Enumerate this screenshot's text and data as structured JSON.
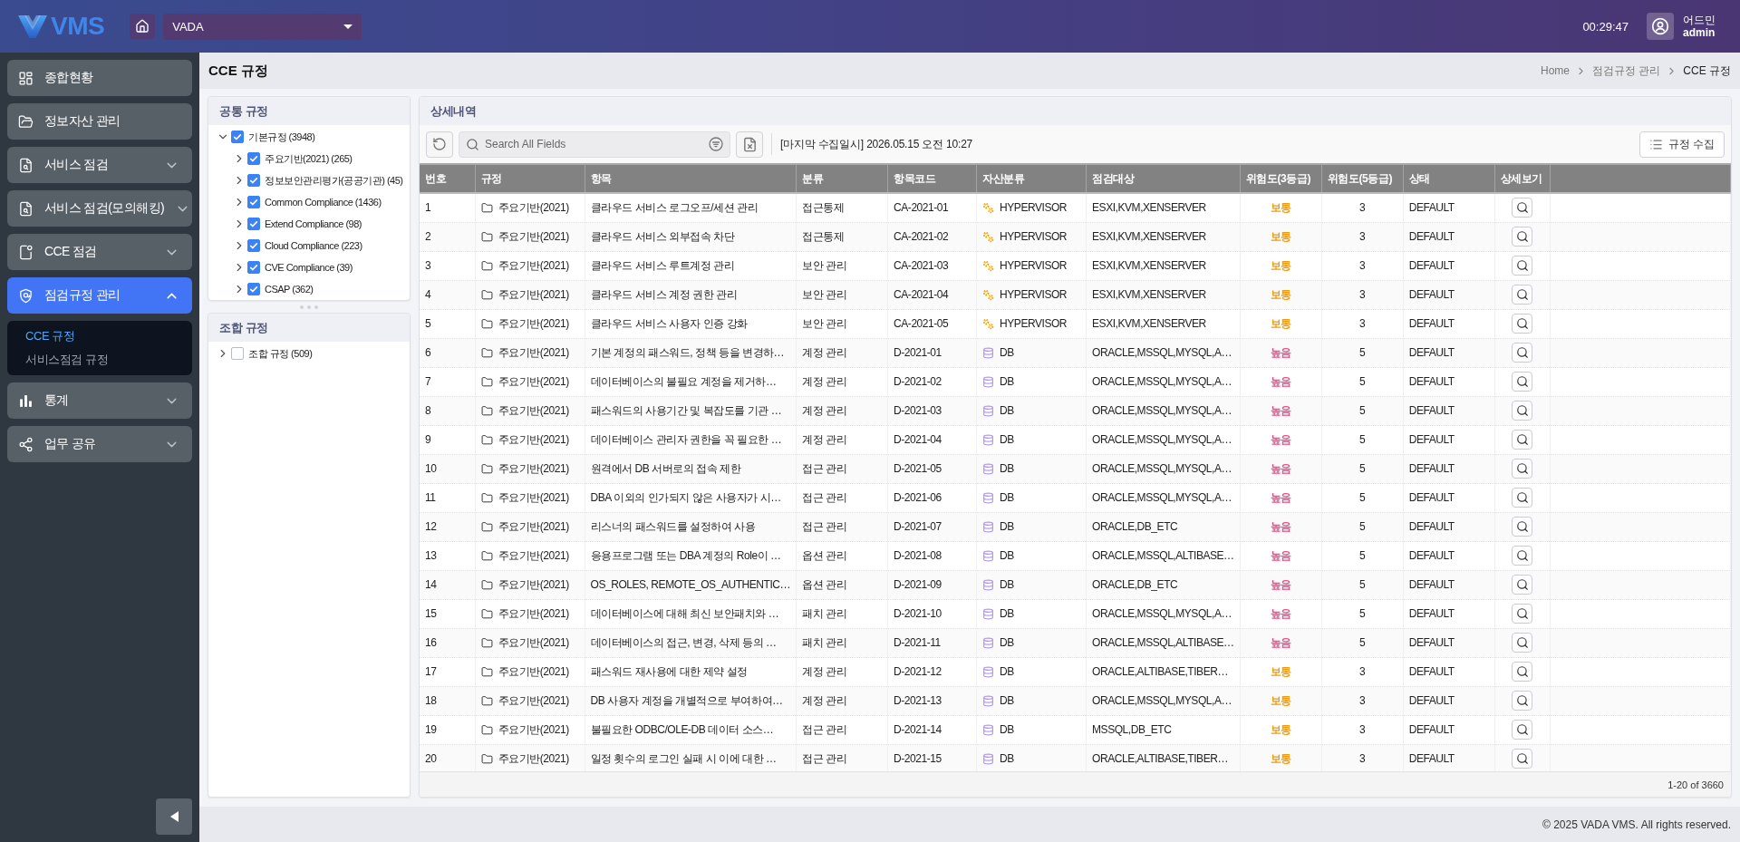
{
  "header": {
    "logo_text": "VMS",
    "site_select": {
      "value": "VADA"
    },
    "clock": "00:29:47",
    "user": {
      "name": "어드민",
      "id": "admin"
    }
  },
  "sidebar": {
    "items": [
      {
        "label": "종합현황",
        "kind": "link",
        "selected": false
      },
      {
        "label": "정보자산 관리",
        "kind": "link",
        "selected": false
      },
      {
        "label": "서비스 점검",
        "kind": "group",
        "selected": false,
        "expanded": false
      },
      {
        "label": "서비스 점검(모의해킹)",
        "kind": "group",
        "selected": false,
        "expanded": false
      },
      {
        "label": "CCE 점검",
        "kind": "group",
        "selected": false,
        "expanded": false
      },
      {
        "label": "점검규정 관리",
        "kind": "group",
        "selected": true,
        "expanded": true,
        "children": [
          {
            "label": "CCE 규정",
            "selected": true
          },
          {
            "label": "서비스점검 규정",
            "selected": false
          }
        ]
      },
      {
        "label": "통계",
        "kind": "group",
        "selected": false,
        "expanded": false
      },
      {
        "label": "업무 공유",
        "kind": "group",
        "selected": false,
        "expanded": false
      }
    ]
  },
  "page": {
    "title": "CCE 규정",
    "breadcrumb": [
      {
        "label": "Home",
        "current": false
      },
      {
        "label": "점검규정 관리",
        "current": false
      },
      {
        "label": "CCE 규정",
        "current": true
      }
    ]
  },
  "common_rules": {
    "title": "공통 규정",
    "tree": [
      {
        "label": "기본규정 (3948)",
        "checked": true,
        "expanded": true,
        "children": [
          {
            "label": "주요기반(2021) (265)",
            "checked": true,
            "expanded": false
          },
          {
            "label": "정보보안관리평가(공공기관) (45)",
            "checked": true,
            "expanded": false
          },
          {
            "label": "Common Compliance (1436)",
            "checked": true,
            "expanded": false
          },
          {
            "label": "Extend Compliance (98)",
            "checked": true,
            "expanded": false
          },
          {
            "label": "Cloud Compliance (223)",
            "checked": true,
            "expanded": false
          },
          {
            "label": "CVE Compliance (39)",
            "checked": true,
            "expanded": false
          },
          {
            "label": "CSAP (362)",
            "checked": true,
            "expanded": false
          }
        ]
      }
    ]
  },
  "combined_rules": {
    "title": "조합 규정",
    "tree": [
      {
        "label": "조합 규정 (509)",
        "checked": false,
        "expanded": false
      }
    ]
  },
  "details": {
    "title": "상세내역",
    "search": {
      "placeholder": "Search All Fields"
    },
    "last_collected": "[마지막 수집일시] 2026.05.15 오전 10:27",
    "collect_button": "규정 수집",
    "table": {
      "columns": [
        "번호",
        "규정",
        "항목",
        "분류",
        "항목코드",
        "자산분류",
        "점검대상",
        "위험도(3등급)",
        "위험도(5등급)",
        "상태",
        "상세보기"
      ],
      "rows": [
        {
          "no": "1",
          "rule": "주요기반(2021)",
          "item": "클라우드 서비스 로그오프/세션 관리",
          "category": "접근통제",
          "code": "CA-2021-01",
          "asset": {
            "kind": "hypervisor",
            "label": "HYPERVISOR"
          },
          "target": "ESXI,KVM,XENSERVER",
          "risk3": {
            "label": "보통",
            "color": "#f59a0c"
          },
          "risk5": "3",
          "status": "DEFAULT"
        },
        {
          "no": "2",
          "rule": "주요기반(2021)",
          "item": "클라우드 서비스 외부접속 차단",
          "category": "접근통제",
          "code": "CA-2021-02",
          "asset": {
            "kind": "hypervisor",
            "label": "HYPERVISOR"
          },
          "target": "ESXI,KVM,XENSERVER",
          "risk3": {
            "label": "보통",
            "color": "#f59a0c"
          },
          "risk5": "3",
          "status": "DEFAULT"
        },
        {
          "no": "3",
          "rule": "주요기반(2021)",
          "item": "클라우드 서비스 루트계정 관리",
          "category": "보안 관리",
          "code": "CA-2021-03",
          "asset": {
            "kind": "hypervisor",
            "label": "HYPERVISOR"
          },
          "target": "ESXI,KVM,XENSERVER",
          "risk3": {
            "label": "보통",
            "color": "#f59a0c"
          },
          "risk5": "3",
          "status": "DEFAULT"
        },
        {
          "no": "4",
          "rule": "주요기반(2021)",
          "item": "클라우드 서비스 계정 권한 관리",
          "category": "보안 관리",
          "code": "CA-2021-04",
          "asset": {
            "kind": "hypervisor",
            "label": "HYPERVISOR"
          },
          "target": "ESXI,KVM,XENSERVER",
          "risk3": {
            "label": "보통",
            "color": "#f59a0c"
          },
          "risk5": "3",
          "status": "DEFAULT"
        },
        {
          "no": "5",
          "rule": "주요기반(2021)",
          "item": "클라우드 서비스 사용자 인증 강화",
          "category": "보안 관리",
          "code": "CA-2021-05",
          "asset": {
            "kind": "hypervisor",
            "label": "HYPERVISOR"
          },
          "target": "ESXI,KVM,XENSERVER",
          "risk3": {
            "label": "보통",
            "color": "#f59a0c"
          },
          "risk5": "3",
          "status": "DEFAULT"
        },
        {
          "no": "6",
          "rule": "주요기반(2021)",
          "item": "기본 계정의 패스워드, 정책 등을 변경하…",
          "category": "계정 관리",
          "code": "D-2021-01",
          "asset": {
            "kind": "db",
            "label": "DB"
          },
          "target": "ORACLE,MSSQL,MYSQL,A…",
          "risk3": {
            "label": "높음",
            "color": "#ee4d8c"
          },
          "risk5": "5",
          "status": "DEFAULT"
        },
        {
          "no": "7",
          "rule": "주요기반(2021)",
          "item": "데이터베이스의 불필요 계정을 제거하…",
          "category": "계정 관리",
          "code": "D-2021-02",
          "asset": {
            "kind": "db",
            "label": "DB"
          },
          "target": "ORACLE,MSSQL,MYSQL,A…",
          "risk3": {
            "label": "높음",
            "color": "#ee4d8c"
          },
          "risk5": "5",
          "status": "DEFAULT"
        },
        {
          "no": "8",
          "rule": "주요기반(2021)",
          "item": "패스워드의 사용기간 및 복잡도를 기관 …",
          "category": "계정 관리",
          "code": "D-2021-03",
          "asset": {
            "kind": "db",
            "label": "DB"
          },
          "target": "ORACLE,MSSQL,MYSQL,A…",
          "risk3": {
            "label": "높음",
            "color": "#ee4d8c"
          },
          "risk5": "5",
          "status": "DEFAULT"
        },
        {
          "no": "9",
          "rule": "주요기반(2021)",
          "item": "데이터베이스 관리자 권한을 꼭 필요한 …",
          "category": "계정 관리",
          "code": "D-2021-04",
          "asset": {
            "kind": "db",
            "label": "DB"
          },
          "target": "ORACLE,MSSQL,MYSQL,A…",
          "risk3": {
            "label": "높음",
            "color": "#ee4d8c"
          },
          "risk5": "5",
          "status": "DEFAULT"
        },
        {
          "no": "10",
          "rule": "주요기반(2021)",
          "item": "원격에서 DB 서버로의 접속 제한",
          "category": "접근 관리",
          "code": "D-2021-05",
          "asset": {
            "kind": "db",
            "label": "DB"
          },
          "target": "ORACLE,MSSQL,MYSQL,A…",
          "risk3": {
            "label": "높음",
            "color": "#ee4d8c"
          },
          "risk5": "5",
          "status": "DEFAULT"
        },
        {
          "no": "11",
          "rule": "주요기반(2021)",
          "item": "DBA 이외의 인가되지 않은 사용자가 시…",
          "category": "접근 관리",
          "code": "D-2021-06",
          "asset": {
            "kind": "db",
            "label": "DB"
          },
          "target": "ORACLE,MSSQL,MYSQL,A…",
          "risk3": {
            "label": "높음",
            "color": "#ee4d8c"
          },
          "risk5": "5",
          "status": "DEFAULT"
        },
        {
          "no": "12",
          "rule": "주요기반(2021)",
          "item": "리스너의 패스워드를 설정하여 사용",
          "category": "접근 관리",
          "code": "D-2021-07",
          "asset": {
            "kind": "db",
            "label": "DB"
          },
          "target": "ORACLE,DB_ETC",
          "risk3": {
            "label": "높음",
            "color": "#ee4d8c"
          },
          "risk5": "5",
          "status": "DEFAULT"
        },
        {
          "no": "13",
          "rule": "주요기반(2021)",
          "item": "응용프로그램 또는 DBA 계정의 Role이 …",
          "category": "옵션 관리",
          "code": "D-2021-08",
          "asset": {
            "kind": "db",
            "label": "DB"
          },
          "target": "ORACLE,MSSQL,ALTIBASE…",
          "risk3": {
            "label": "높음",
            "color": "#ee4d8c"
          },
          "risk5": "5",
          "status": "DEFAULT"
        },
        {
          "no": "14",
          "rule": "주요기반(2021)",
          "item": "OS_ROLES, REMOTE_OS_AUTHENTIC…",
          "category": "옵션 관리",
          "code": "D-2021-09",
          "asset": {
            "kind": "db",
            "label": "DB"
          },
          "target": "ORACLE,DB_ETC",
          "risk3": {
            "label": "높음",
            "color": "#ee4d8c"
          },
          "risk5": "5",
          "status": "DEFAULT"
        },
        {
          "no": "15",
          "rule": "주요기반(2021)",
          "item": "데이터베이스에 대해 최신 보안패치와 …",
          "category": "패치 관리",
          "code": "D-2021-10",
          "asset": {
            "kind": "db",
            "label": "DB"
          },
          "target": "ORACLE,MSSQL,MYSQL,A…",
          "risk3": {
            "label": "높음",
            "color": "#ee4d8c"
          },
          "risk5": "5",
          "status": "DEFAULT"
        },
        {
          "no": "16",
          "rule": "주요기반(2021)",
          "item": "데이터베이스의 접근, 변경, 삭제 등의 …",
          "category": "패치 관리",
          "code": "D-2021-11",
          "asset": {
            "kind": "db",
            "label": "DB"
          },
          "target": "ORACLE,MSSQL,ALTIBASE…",
          "risk3": {
            "label": "높음",
            "color": "#ee4d8c"
          },
          "risk5": "5",
          "status": "DEFAULT"
        },
        {
          "no": "17",
          "rule": "주요기반(2021)",
          "item": "패스워드 재사용에 대한 제약 설정",
          "category": "계정 관리",
          "code": "D-2021-12",
          "asset": {
            "kind": "db",
            "label": "DB"
          },
          "target": "ORACLE,ALTIBASE,TIBER…",
          "risk3": {
            "label": "보통",
            "color": "#f59a0c"
          },
          "risk5": "3",
          "status": "DEFAULT"
        },
        {
          "no": "18",
          "rule": "주요기반(2021)",
          "item": "DB 사용자 계정을 개별적으로 부여하여…",
          "category": "계정 관리",
          "code": "D-2021-13",
          "asset": {
            "kind": "db",
            "label": "DB"
          },
          "target": "ORACLE,MSSQL,MYSQL,A…",
          "risk3": {
            "label": "보통",
            "color": "#f59a0c"
          },
          "risk5": "3",
          "status": "DEFAULT"
        },
        {
          "no": "19",
          "rule": "주요기반(2021)",
          "item": "불필요한 ODBC/OLE-DB 데이터 소스…",
          "category": "접근 관리",
          "code": "D-2021-14",
          "asset": {
            "kind": "db",
            "label": "DB"
          },
          "target": "MSSQL,DB_ETC",
          "risk3": {
            "label": "보통",
            "color": "#f59a0c"
          },
          "risk5": "3",
          "status": "DEFAULT"
        },
        {
          "no": "20",
          "rule": "주요기반(2021)",
          "item": "일정 횟수의 로그인 실패 시 이에 대한 …",
          "category": "접근 관리",
          "code": "D-2021-15",
          "asset": {
            "kind": "db",
            "label": "DB"
          },
          "target": "ORACLE,ALTIBASE,TIBER…",
          "risk3": {
            "label": "보통",
            "color": "#f59a0c"
          },
          "risk5": "3",
          "status": "DEFAULT"
        }
      ]
    },
    "pagination": "1-20 of 3660"
  },
  "footer": {
    "copyright": "© 2025 VADA VMS. All rights reserved."
  }
}
